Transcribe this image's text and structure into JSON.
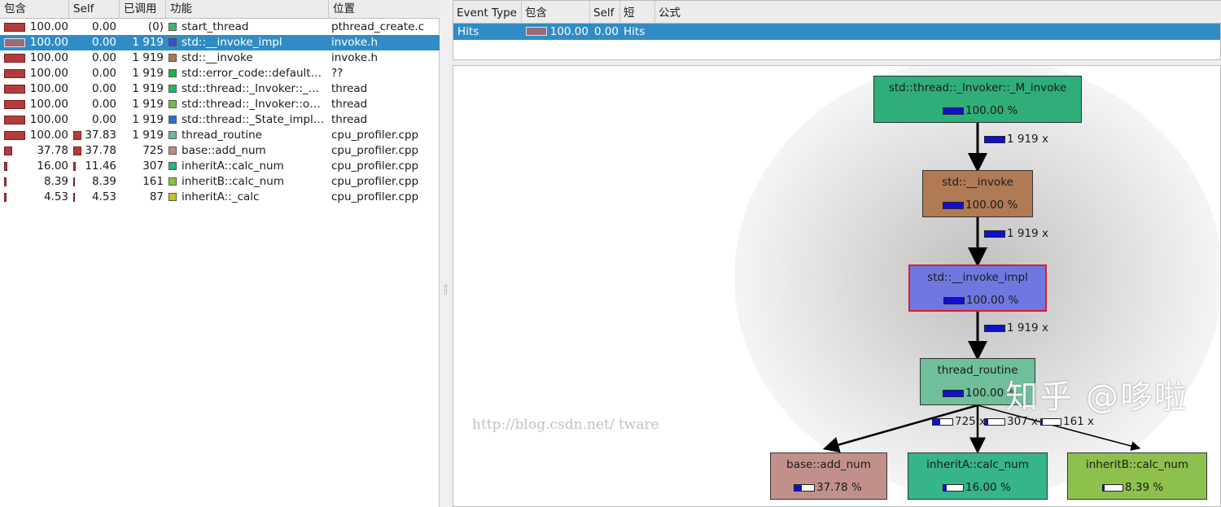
{
  "function_list": {
    "columns": [
      "包含",
      "Self",
      "已调用",
      "功能",
      "位置"
    ],
    "rows": [
      {
        "incl": "100.00",
        "self": "0.00",
        "called": "(0)",
        "func": "start_thread",
        "loc": "pthread_create.c",
        "color": "#3cb371",
        "incl_frac": 1.0,
        "self_frac": 0.0
      },
      {
        "incl": "100.00",
        "self": "0.00",
        "called": "1 919",
        "func": "std::__invoke_impl",
        "loc": "invoke.h",
        "color": "#3a4bd0",
        "incl_frac": 1.0,
        "self_frac": 0.0,
        "selected": true
      },
      {
        "incl": "100.00",
        "self": "0.00",
        "called": "1 919",
        "func": "std::__invoke",
        "loc": "invoke.h",
        "color": "#b07850",
        "incl_frac": 1.0,
        "self_frac": 0.0
      },
      {
        "incl": "100.00",
        "self": "0.00",
        "called": "1 919",
        "func": "std::error_code::default…",
        "loc": "??",
        "color": "#22b050",
        "incl_frac": 1.0,
        "self_frac": 0.0
      },
      {
        "incl": "100.00",
        "self": "0.00",
        "called": "1 919",
        "func": "std::thread::_Invoker::_…",
        "loc": "thread",
        "color": "#2db36a",
        "incl_frac": 1.0,
        "self_frac": 0.0
      },
      {
        "incl": "100.00",
        "self": "0.00",
        "called": "1 919",
        "func": "std::thread::_Invoker::o…",
        "loc": "thread",
        "color": "#6fbf40",
        "incl_frac": 1.0,
        "self_frac": 0.0
      },
      {
        "incl": "100.00",
        "self": "0.00",
        "called": "1 919",
        "func": "std::thread::_State_impl…",
        "loc": "thread",
        "color": "#2a6fd0",
        "incl_frac": 1.0,
        "self_frac": 0.0
      },
      {
        "incl": "100.00",
        "self": "37.83",
        "called": "1 919",
        "func": "thread_routine",
        "loc": "cpu_profiler.cpp",
        "color": "#6fb89a",
        "incl_frac": 1.0,
        "self_frac": 0.3783
      },
      {
        "incl": "37.78",
        "self": "37.78",
        "called": "725",
        "func": "base::add_num",
        "loc": "cpu_profiler.cpp",
        "color": "#c08a86",
        "incl_frac": 0.3778,
        "self_frac": 0.3778
      },
      {
        "incl": "16.00",
        "self": "11.46",
        "called": "307",
        "func": "inheritA::calc_num",
        "loc": "cpu_profiler.cpp",
        "color": "#30b08a",
        "incl_frac": 0.16,
        "self_frac": 0.1146
      },
      {
        "incl": "8.39",
        "self": "8.39",
        "called": "161",
        "func": "inheritB::calc_num",
        "loc": "cpu_profiler.cpp",
        "color": "#8ec04a",
        "incl_frac": 0.0839,
        "self_frac": 0.0839
      },
      {
        "incl": "4.53",
        "self": "4.53",
        "called": "87",
        "func": "inheritA::_calc",
        "loc": "cpu_profiler.cpp",
        "color": "#c8c020",
        "incl_frac": 0.0453,
        "self_frac": 0.0453
      }
    ]
  },
  "event_types": {
    "columns": [
      "Event Type",
      "包含",
      "Self",
      "短",
      "公式"
    ],
    "rows": [
      {
        "type": "Hits",
        "incl": "100.00",
        "self": "0.00",
        "short": "Hits",
        "formula": ""
      }
    ]
  },
  "call_graph": {
    "nodes": [
      {
        "id": "m_invoke",
        "label": "std::thread::_Invoker::_M_invoke",
        "pct": "100.00 %",
        "frac": 1.0,
        "color": "#2fae7a"
      },
      {
        "id": "invoke",
        "label": "std::__invoke",
        "pct": "100.00 %",
        "frac": 1.0,
        "color": "#b07a55"
      },
      {
        "id": "invoke_impl",
        "label": "std::__invoke_impl",
        "pct": "100.00 %",
        "frac": 1.0,
        "color": "#6f78e0",
        "selected": true
      },
      {
        "id": "thread_routine",
        "label": "thread_routine",
        "pct": "100.00 %",
        "frac": 1.0,
        "color": "#6fbf9a"
      },
      {
        "id": "add_num",
        "label": "base::add_num",
        "pct": "37.78 %",
        "frac": 0.3778,
        "color": "#c2908a"
      },
      {
        "id": "calc_a",
        "label": "inheritA::calc_num",
        "pct": "16.00 %",
        "frac": 0.16,
        "color": "#36b48a"
      },
      {
        "id": "calc_b",
        "label": "inheritB::calc_num",
        "pct": "8.39 %",
        "frac": 0.0839,
        "color": "#8ec04e"
      }
    ],
    "edges": [
      {
        "from": "m_invoke",
        "to": "invoke",
        "label": "1 919 x",
        "frac": 1.0
      },
      {
        "from": "invoke",
        "to": "invoke_impl",
        "label": "1 919 x",
        "frac": 1.0
      },
      {
        "from": "invoke_impl",
        "to": "thread_routine",
        "label": "1 919 x",
        "frac": 1.0
      },
      {
        "from": "thread_routine",
        "to": "add_num",
        "label": "725 x",
        "frac": 0.3778
      },
      {
        "from": "thread_routine",
        "to": "calc_a",
        "label": "307 x",
        "frac": 0.16
      },
      {
        "from": "thread_routine",
        "to": "calc_b",
        "label": "161 x",
        "frac": 0.0839
      }
    ]
  },
  "watermark": {
    "text": "知乎 @哆啦",
    "url": "http://blog.csdn.net/     tware"
  }
}
